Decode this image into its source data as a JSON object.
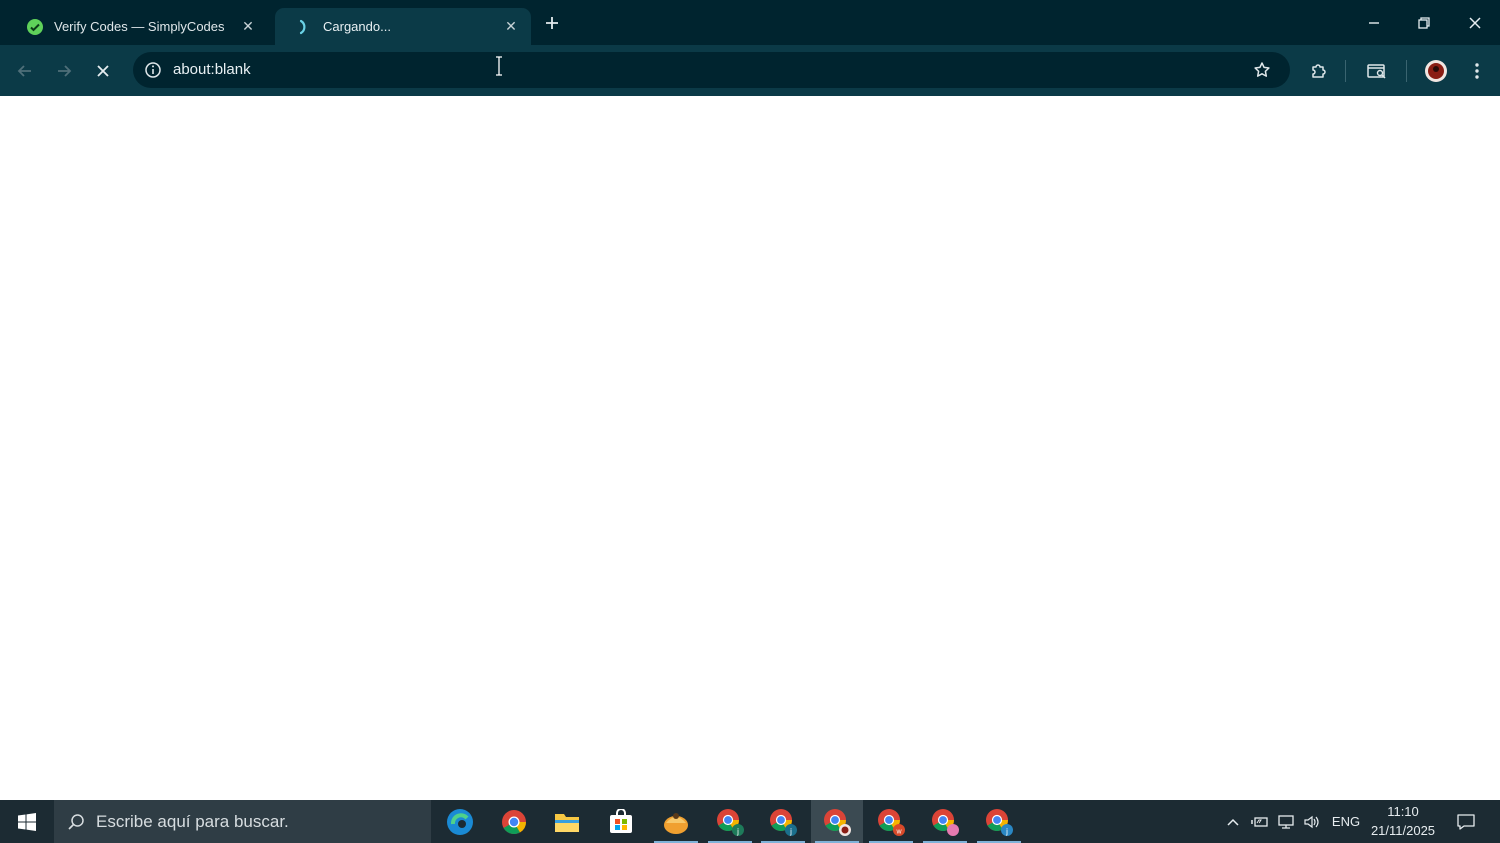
{
  "browser": {
    "tabs": [
      {
        "title": "Verify Codes — SimplyCodes",
        "favicon": "simplycodes-icon",
        "active": false
      },
      {
        "title": "Cargando...",
        "favicon": "loading-spinner-icon",
        "active": true
      }
    ],
    "address_bar": {
      "url": "about:blank"
    },
    "colors": {
      "tabstrip": "#00242f",
      "toolbar": "#0b3a47",
      "omnibox": "#00242f"
    }
  },
  "taskbar": {
    "search_placeholder": "Escribe aquí para buscar.",
    "apps": [
      "edge-icon",
      "chrome-icon",
      "file-explorer-icon",
      "microsoft-store-icon",
      "app-icon",
      "chrome-profile-j-icon",
      "chrome-profile-j2-icon",
      "chrome-profile-active-icon",
      "chrome-profile-w-icon",
      "chrome-profile-pink-icon",
      "chrome-profile-j3-icon"
    ],
    "tray": {
      "language": "ENG",
      "time": "11:10",
      "date": "21/11/2025"
    }
  }
}
